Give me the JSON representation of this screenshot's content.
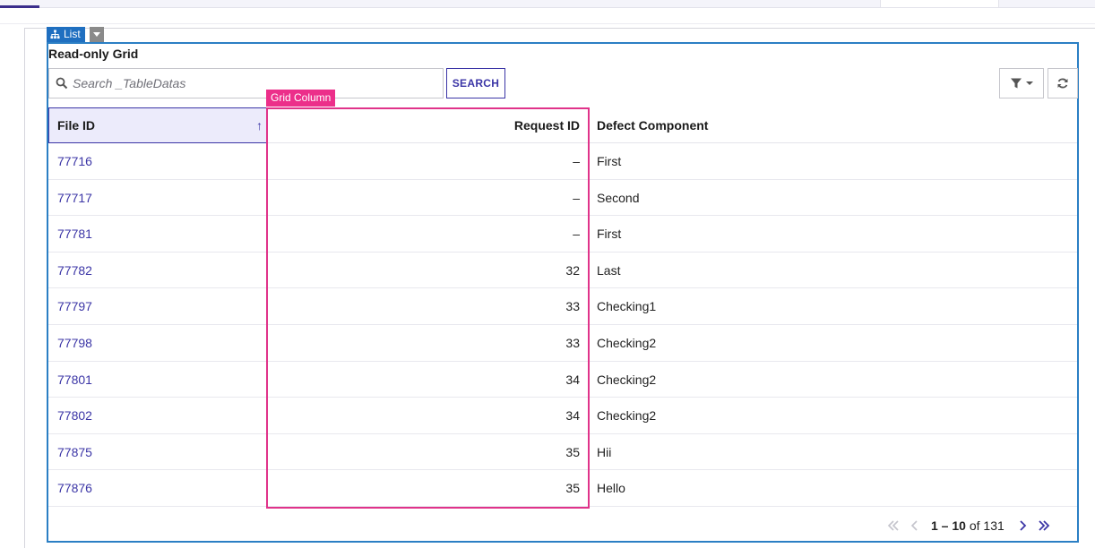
{
  "list_tag": {
    "label": "List"
  },
  "grid": {
    "title": "Read-only Grid"
  },
  "search": {
    "placeholder": "Search _TableDatas",
    "value": "",
    "button_label": "SEARCH"
  },
  "grid_column_tag": "Grid Column",
  "columns": {
    "file_id": "File ID",
    "request_id": "Request ID",
    "defect_component": "Defect Component"
  },
  "rows": [
    {
      "file_id": "77716",
      "request_id": "–",
      "defect_component": "First"
    },
    {
      "file_id": "77717",
      "request_id": "–",
      "defect_component": "Second"
    },
    {
      "file_id": "77781",
      "request_id": "–",
      "defect_component": "First"
    },
    {
      "file_id": "77782",
      "request_id": "32",
      "defect_component": "Last"
    },
    {
      "file_id": "77797",
      "request_id": "33",
      "defect_component": "Checking1"
    },
    {
      "file_id": "77798",
      "request_id": "33",
      "defect_component": "Checking2"
    },
    {
      "file_id": "77801",
      "request_id": "34",
      "defect_component": "Checking2"
    },
    {
      "file_id": "77802",
      "request_id": "34",
      "defect_component": "Checking2"
    },
    {
      "file_id": "77875",
      "request_id": "35",
      "defect_component": "Hii"
    },
    {
      "file_id": "77876",
      "request_id": "35",
      "defect_component": "Hello"
    }
  ],
  "pager": {
    "range": "1 – 10",
    "of_label": "of",
    "total": "131"
  },
  "icons": {
    "list_tag": "sitemap-icon",
    "list_dropdown": "caret-down-icon",
    "search": "search-icon",
    "sort": "sort-ascending-icon",
    "filter": "filter-icon",
    "refresh": "refresh-icon",
    "pager_first": "double-chevron-left-icon",
    "pager_prev": "chevron-left-icon",
    "pager_next": "chevron-right-icon",
    "pager_last": "double-chevron-right-icon"
  },
  "colors": {
    "accent": "#3b35a6",
    "frame": "#2b7fc4",
    "highlight": "#e0338a",
    "list_tag": "#1f6fc0"
  }
}
